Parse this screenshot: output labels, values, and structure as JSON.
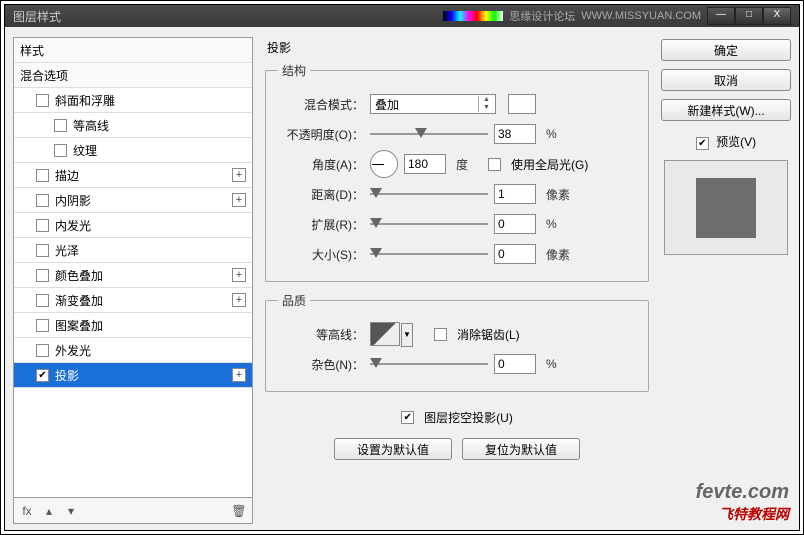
{
  "titlebar": {
    "title": "图层样式",
    "brand": "思缘设计论坛",
    "brand_url": "WWW.MISSYUAN.COM"
  },
  "winbtns": {
    "min": "—",
    "max": "□",
    "close": "X"
  },
  "sidebar": {
    "header": "样式",
    "blend_header": "混合选项",
    "items": [
      {
        "label": "斜面和浮雕",
        "checked": false,
        "plus": false,
        "indent": 1
      },
      {
        "label": "等高线",
        "checked": false,
        "plus": false,
        "indent": 2
      },
      {
        "label": "纹理",
        "checked": false,
        "plus": false,
        "indent": 2
      },
      {
        "label": "描边",
        "checked": false,
        "plus": true,
        "indent": 1
      },
      {
        "label": "内阴影",
        "checked": false,
        "plus": true,
        "indent": 1
      },
      {
        "label": "内发光",
        "checked": false,
        "plus": false,
        "indent": 1
      },
      {
        "label": "光泽",
        "checked": false,
        "plus": false,
        "indent": 1
      },
      {
        "label": "颜色叠加",
        "checked": false,
        "plus": true,
        "indent": 1
      },
      {
        "label": "渐变叠加",
        "checked": false,
        "plus": true,
        "indent": 1
      },
      {
        "label": "图案叠加",
        "checked": false,
        "plus": false,
        "indent": 1
      },
      {
        "label": "外发光",
        "checked": false,
        "plus": false,
        "indent": 1
      },
      {
        "label": "投影",
        "checked": true,
        "plus": true,
        "indent": 1,
        "selected": true
      }
    ],
    "footer": {
      "fx": "fx",
      "arrows": "▲ ▼",
      "trash": "🗑"
    }
  },
  "panel": {
    "title": "投影",
    "struct": {
      "legend": "结构",
      "blend_label": "混合模式：",
      "blend_value": "叠加",
      "opacity_label": "不透明度(O)：",
      "opacity_value": "38",
      "opacity_unit": "%",
      "angle_label": "角度(A)：",
      "angle_value": "180",
      "angle_unit": "度",
      "global_label": "使用全局光(G)",
      "distance_label": "距离(D)：",
      "distance_value": "1",
      "distance_unit": "像素",
      "spread_label": "扩展(R)：",
      "spread_value": "0",
      "spread_unit": "%",
      "size_label": "大小(S)：",
      "size_value": "0",
      "size_unit": "像素"
    },
    "quality": {
      "legend": "品质",
      "contour_label": "等高线：",
      "aa_label": "消除锯齿(L)",
      "noise_label": "杂色(N)：",
      "noise_value": "0",
      "noise_unit": "%"
    },
    "knockout_label": "图层挖空投影(U)",
    "knockout_checked": true,
    "btn_default": "设置为默认值",
    "btn_reset": "复位为默认值"
  },
  "right": {
    "ok": "确定",
    "cancel": "取消",
    "newstyle": "新建样式(W)...",
    "preview_label": "预览(V)",
    "preview_checked": true
  },
  "watermark": {
    "l1": "fevte.com",
    "l2": "飞特教程网"
  }
}
